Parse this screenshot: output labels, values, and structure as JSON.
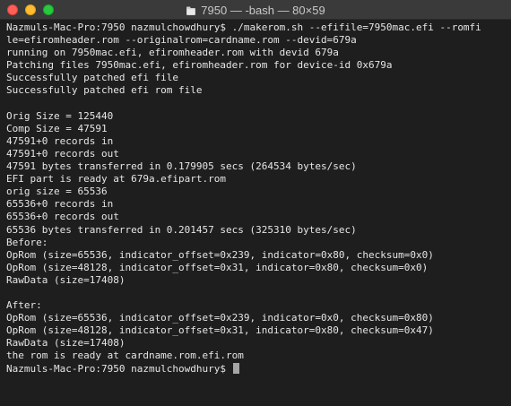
{
  "window": {
    "title": "7950 — -bash — 80×59",
    "title_icon": "home-folder-icon",
    "colors": {
      "background": "#1e1e1e",
      "text": "#e6e6e6",
      "titlebar": "#3a3a3a",
      "close": "#ff5f57",
      "minimize": "#febc2e",
      "maximize": "#28c840"
    }
  },
  "terminal": {
    "lines": [
      "Nazmuls-Mac-Pro:7950 nazmulchowdhury$ ./makerom.sh --efifile=7950mac.efi --romfi",
      "le=efiromheader.rom --originalrom=cardname.rom --devid=679a",
      "running on 7950mac.efi, efiromheader.rom with devid 679a",
      "Patching files 7950mac.efi, efiromheader.rom for device-id 0x679a",
      "Successfully patched efi file",
      "Successfully patched efi rom file",
      "",
      "Orig Size = 125440",
      "Comp Size = 47591",
      "47591+0 records in",
      "47591+0 records out",
      "47591 bytes transferred in 0.179905 secs (264534 bytes/sec)",
      "EFI part is ready at 679a.efipart.rom",
      "orig size = 65536",
      "65536+0 records in",
      "65536+0 records out",
      "65536 bytes transferred in 0.201457 secs (325310 bytes/sec)",
      "Before:",
      "OpRom (size=65536, indicator_offset=0x239, indicator=0x80, checksum=0x0)",
      "OpRom (size=48128, indicator_offset=0x31, indicator=0x80, checksum=0x0)",
      "RawData (size=17408)",
      "",
      "After:",
      "OpRom (size=65536, indicator_offset=0x239, indicator=0x0, checksum=0x80)",
      "OpRom (size=48128, indicator_offset=0x31, indicator=0x80, checksum=0x47)",
      "RawData (size=17408)",
      "the rom is ready at cardname.rom.efi.rom"
    ],
    "prompt": "Nazmuls-Mac-Pro:7950 nazmulchowdhury$ "
  }
}
